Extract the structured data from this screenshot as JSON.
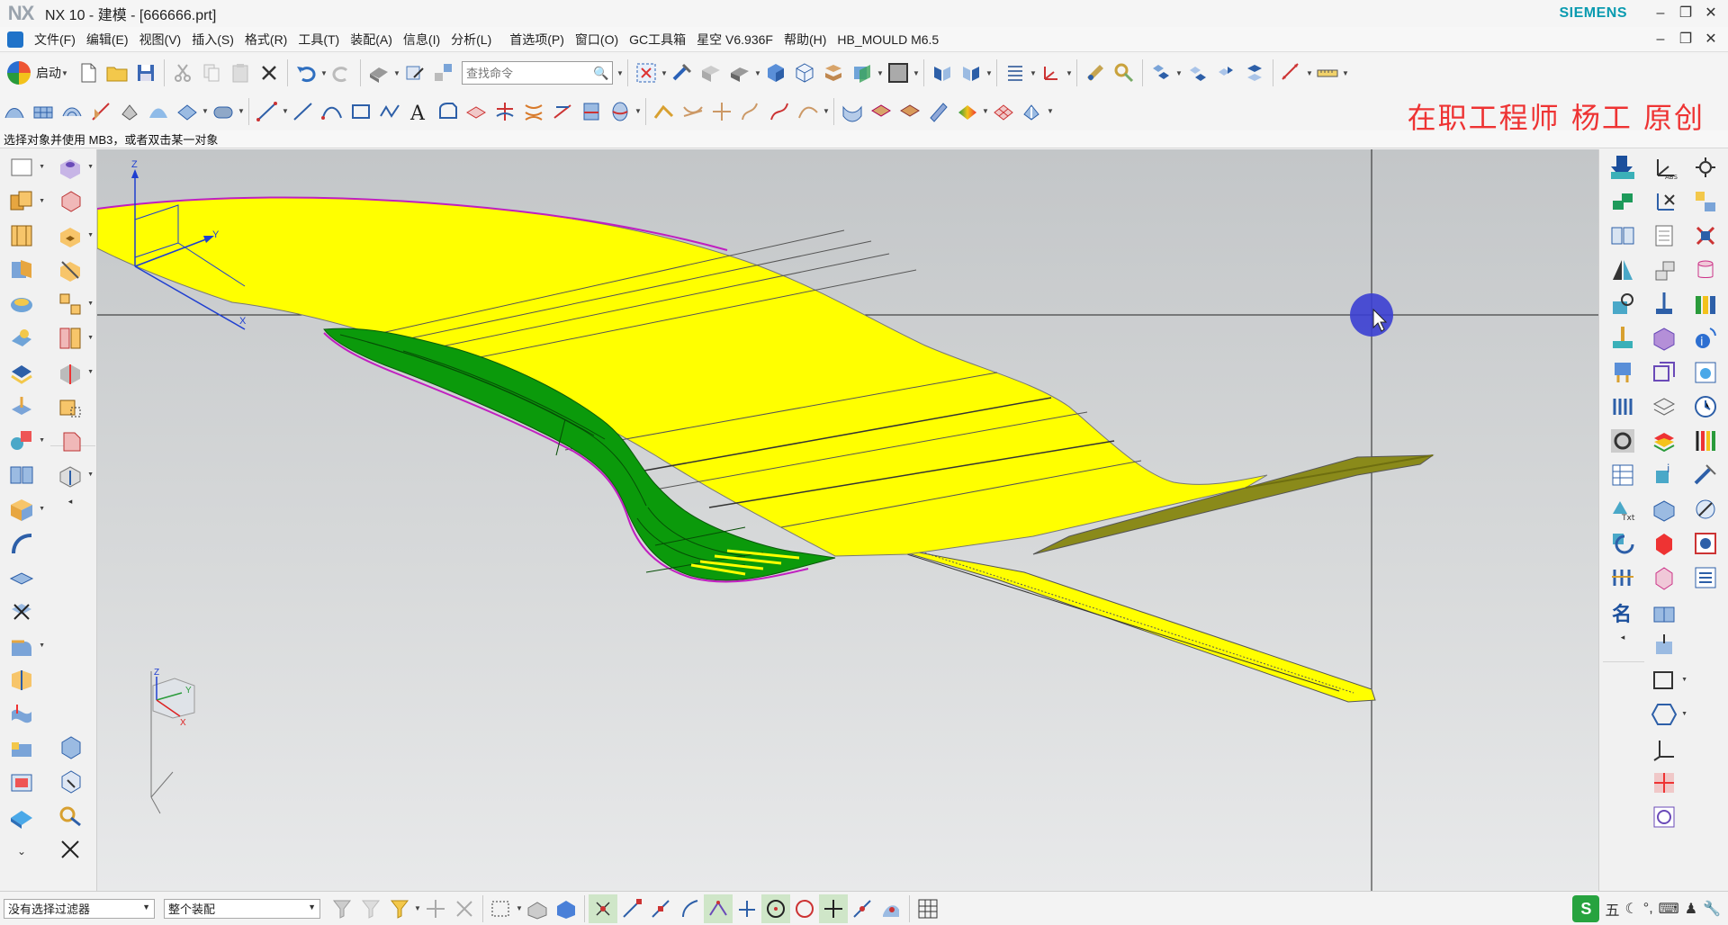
{
  "window": {
    "logo": "NX",
    "title": "NX 10 - 建模 - [666666.prt]",
    "brand": "SIEMENS",
    "controls": [
      "–",
      "❐",
      "✕"
    ],
    "doc_controls": [
      "–",
      "❐",
      "✕"
    ]
  },
  "menu": {
    "items": [
      "文件(F)",
      "编辑(E)",
      "视图(V)",
      "插入(S)",
      "格式(R)",
      "工具(T)",
      "装配(A)",
      "信息(I)",
      "分析(L)",
      "首选项(P)",
      "窗口(O)",
      "GC工具箱",
      "星空 V6.936F",
      "帮助(H)",
      "HB_MOULD M6.5"
    ]
  },
  "toolbar": {
    "start_label": "启动",
    "search_placeholder": "查找命令",
    "search_icon": "🔍"
  },
  "watermark": "在职工程师  杨工  原创",
  "cue": "选择对象并使用 MB3，或者双击某一对象",
  "viewport": {
    "axis_labels": {
      "z": "Z",
      "y": "Y",
      "x": "X"
    },
    "triad_labels": {
      "z": "Z",
      "y": "Y",
      "x": "X"
    },
    "colors": {
      "surface": "#ffff00",
      "fillet": "#0b9a0b",
      "edge": "#c01fc0",
      "background_top": "#c3c6c8",
      "background_bottom": "#e8e9ea",
      "cursor": "#3b3fd1"
    }
  },
  "status": {
    "filter_value": "没有选择过滤器",
    "scope_value": "整个装配"
  },
  "ime": {
    "logo": "S",
    "items": [
      "五",
      "☾",
      "°,",
      "⌨",
      "♟",
      "🔧"
    ]
  }
}
